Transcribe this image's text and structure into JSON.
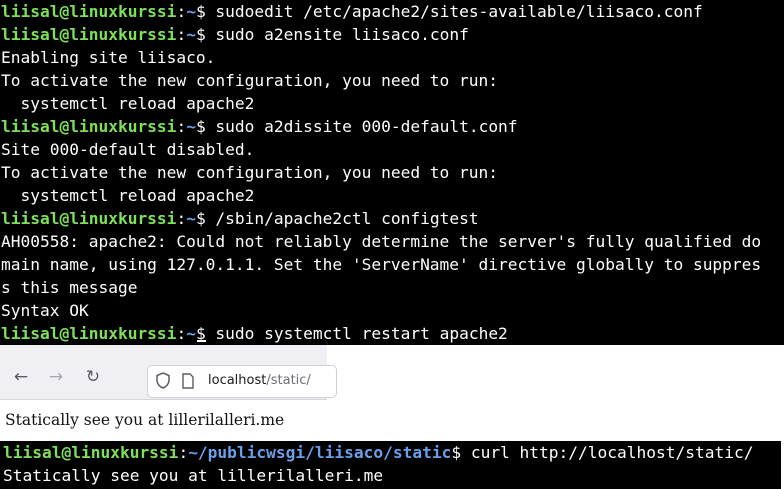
{
  "terminal_top": {
    "lines": [
      {
        "type": "prompt",
        "user": "liisal@linuxkurssi",
        "sep": ":",
        "path": "~",
        "dollar": "$",
        "cmd": " sudoedit /etc/apache2/sites-available/liisaco.conf"
      },
      {
        "type": "prompt",
        "user": "liisal@linuxkurssi",
        "sep": ":",
        "path": "~",
        "dollar": "$",
        "cmd": " sudo a2ensite liisaco.conf"
      },
      {
        "type": "out",
        "text": "Enabling site liisaco."
      },
      {
        "type": "out",
        "text": "To activate the new configuration, you need to run:"
      },
      {
        "type": "out",
        "text": "  systemctl reload apache2"
      },
      {
        "type": "prompt",
        "user": "liisal@linuxkurssi",
        "sep": ":",
        "path": "~",
        "dollar": "$",
        "cmd": " sudo a2dissite 000-default.conf"
      },
      {
        "type": "out",
        "text": "Site 000-default disabled."
      },
      {
        "type": "out",
        "text": "To activate the new configuration, you need to run:"
      },
      {
        "type": "out",
        "text": "  systemctl reload apache2"
      },
      {
        "type": "prompt",
        "user": "liisal@linuxkurssi",
        "sep": ":",
        "path": "~",
        "dollar": "$",
        "cmd": " /sbin/apache2ctl configtest"
      },
      {
        "type": "out",
        "text": "AH00558: apache2: Could not reliably determine the server's fully qualified do"
      },
      {
        "type": "out",
        "text": "main name, using 127.0.1.1. Set the 'ServerName' directive globally to suppres"
      },
      {
        "type": "out",
        "text": "s this message"
      },
      {
        "type": "out",
        "text": "Syntax OK"
      },
      {
        "type": "prompt",
        "user": "liisal@linuxkurssi",
        "sep": ":",
        "path": "~",
        "dollar": "$",
        "cmd": " sudo systemctl restart apache2"
      }
    ]
  },
  "browser": {
    "back_icon": "arrow-left-icon",
    "forward_icon": "arrow-right-icon",
    "reload_icon": "reload-icon",
    "url_host": "localhost",
    "url_path": "/static/",
    "page_text": "Statically see you at lillerilalleri.me"
  },
  "terminal_bottom": {
    "prompt_user": "liisal@linuxkurssi",
    "prompt_sep": ":",
    "prompt_path": "~/publicwsgi/liisaco/static",
    "prompt_dollar": "$",
    "prompt_cmd": " curl http://localhost/static/",
    "output": "Statically see you at lillerilalleri.me"
  },
  "colors": {
    "prompt_user": "#7ee05a",
    "prompt_path": "#6aa0ea",
    "terminal_bg": "#000000",
    "toolbar_bg": "#f0f0f4"
  }
}
